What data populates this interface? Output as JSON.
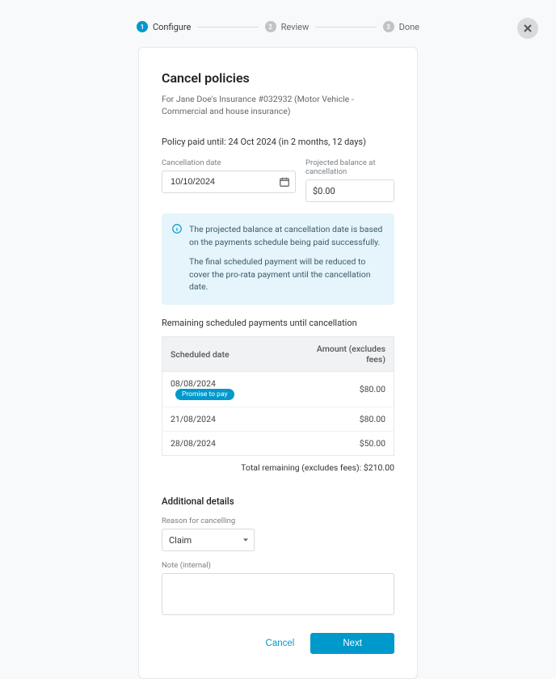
{
  "stepper": {
    "steps": [
      {
        "num": "1",
        "label": "Configure",
        "active": true
      },
      {
        "num": "2",
        "label": "Review",
        "active": false
      },
      {
        "num": "3",
        "label": "Done",
        "active": false
      }
    ]
  },
  "title": "Cancel policies",
  "subtitle": "For Jane Doe's Insurance #032932 (Motor Vehicle - Commercial and house insurance)",
  "paid_until": "Policy paid until: 24 Oct 2024 (in 2 months, 12 days)",
  "fields": {
    "cancellation_date": {
      "label": "Cancellation date",
      "value": "10/10/2024"
    },
    "projected_balance": {
      "label": "Projected balance at cancellation",
      "value": "$0.00"
    }
  },
  "info": {
    "p1": "The projected balance at cancellation date is based on the payments schedule being paid successfully.",
    "p2": "The final scheduled payment will be reduced to cover the pro-rata payment until the cancellation date."
  },
  "remaining_label": "Remaining scheduled payments until cancellation",
  "table": {
    "headers": {
      "date": "Scheduled date",
      "amount": "Amount (excludes fees)"
    },
    "rows": [
      {
        "date": "08/08/2024",
        "badge": "Promise to pay",
        "amount": "$80.00"
      },
      {
        "date": "21/08/2024",
        "badge": "",
        "amount": "$80.00"
      },
      {
        "date": "28/08/2024",
        "badge": "",
        "amount": "$50.00"
      }
    ]
  },
  "total_remaining": "Total remaining (excludes fees): $210.00",
  "additional": {
    "title": "Additional details",
    "reason_label": "Reason for cancelling",
    "reason_value": "Claim",
    "note_label": "Note (internal)"
  },
  "actions": {
    "cancel": "Cancel",
    "next": "Next"
  }
}
